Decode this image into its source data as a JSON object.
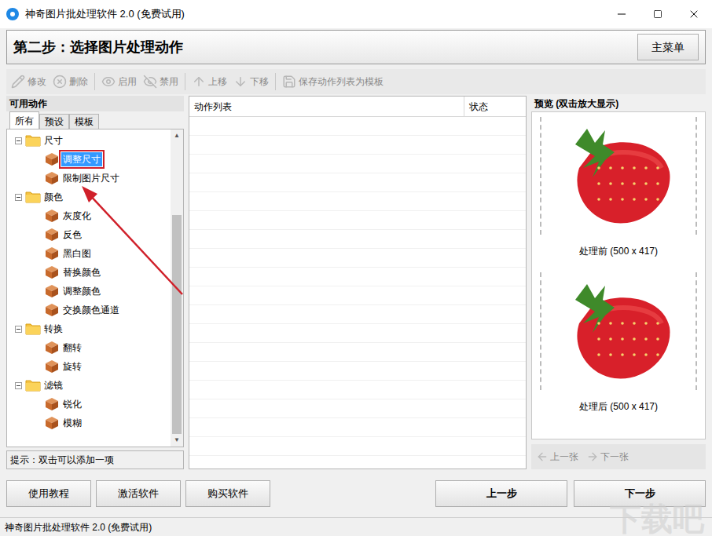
{
  "window": {
    "title": "神奇图片批处理软件 2.0 (免费试用)",
    "controls": [
      "minimize",
      "maximize",
      "close"
    ]
  },
  "header": {
    "title": "第二步：选择图片处理动作",
    "menu_button": "主菜单"
  },
  "toolbar": [
    {
      "label": "修改",
      "icon": "edit",
      "disabled": true
    },
    {
      "label": "删除",
      "icon": "delete",
      "disabled": true
    },
    {
      "label": "启用",
      "icon": "enable",
      "disabled": true
    },
    {
      "label": "禁用",
      "icon": "disable",
      "disabled": true
    },
    {
      "label": "上移",
      "icon": "up",
      "disabled": true
    },
    {
      "label": "下移",
      "icon": "down",
      "disabled": true
    },
    {
      "label": "保存动作列表为模板",
      "icon": "save",
      "disabled": true
    }
  ],
  "actions_panel": {
    "title": "可用动作",
    "tabs": [
      {
        "label": "所有",
        "selected": true
      },
      {
        "label": "预设",
        "selected": false
      },
      {
        "label": "模板",
        "selected": false
      }
    ],
    "tree": [
      {
        "name": "尺寸",
        "expanded": true,
        "children": [
          {
            "name": "调整尺寸",
            "selected": true,
            "highlighted": true
          },
          {
            "name": "限制图片尺寸",
            "selected": false,
            "highlighted": false
          }
        ]
      },
      {
        "name": "颜色",
        "expanded": true,
        "children": [
          {
            "name": "灰度化",
            "selected": false,
            "highlighted": false
          },
          {
            "name": "反色",
            "selected": false,
            "highlighted": false
          },
          {
            "name": "黑白图",
            "selected": false,
            "highlighted": false
          },
          {
            "name": "替换颜色",
            "selected": false,
            "highlighted": false
          },
          {
            "name": "调整颜色",
            "selected": false,
            "highlighted": false
          },
          {
            "name": "交换颜色通道",
            "selected": false,
            "highlighted": false
          }
        ]
      },
      {
        "name": "转换",
        "expanded": true,
        "children": [
          {
            "name": "翻转",
            "selected": false,
            "highlighted": false
          },
          {
            "name": "旋转",
            "selected": false,
            "highlighted": false
          }
        ]
      },
      {
        "name": "滤镜",
        "expanded": true,
        "children": [
          {
            "name": "锐化",
            "selected": false,
            "highlighted": false
          },
          {
            "name": "模糊",
            "selected": false,
            "highlighted": false
          }
        ]
      }
    ],
    "scroll_level": 0.75,
    "hint": "提示：双击可以添加一项"
  },
  "action_list": {
    "columns": [
      "动作列表",
      "状态"
    ],
    "rows": []
  },
  "preview": {
    "title": "预览 (双击放大显示)",
    "before": "处理前 (500 x 417)",
    "after": "处理后 (500 x 417)",
    "prev": {
      "label": "上一张",
      "disabled": true
    },
    "next": {
      "label": "下一张",
      "disabled": true
    }
  },
  "bottom_buttons_left": [
    "使用教程",
    "激活软件",
    "购买软件"
  ],
  "bottom_buttons_right": [
    "上一步",
    "下一步"
  ],
  "status_bar": "神奇图片批处理软件 2.0 (免费试用)",
  "watermark": "下载吧"
}
